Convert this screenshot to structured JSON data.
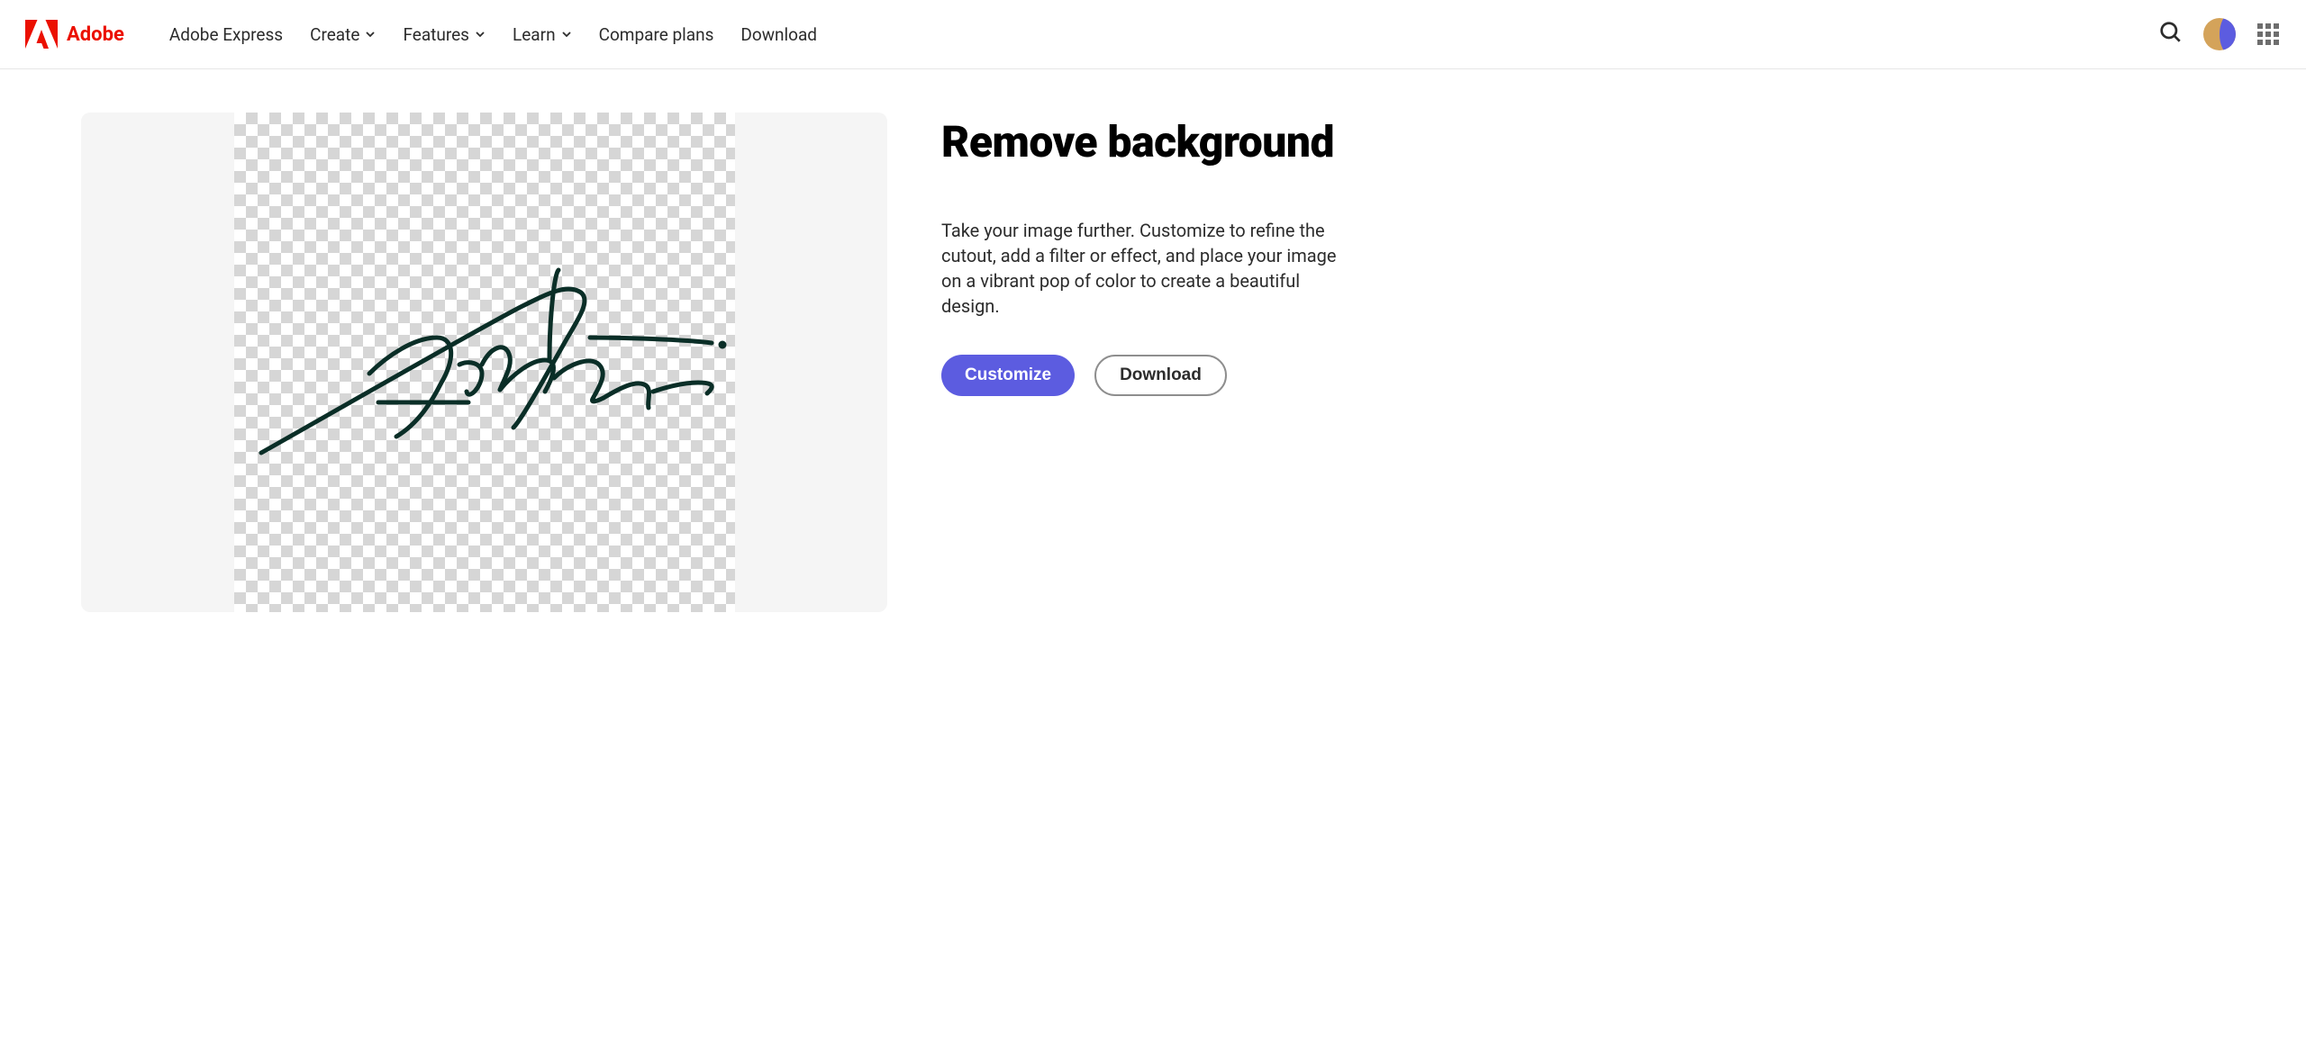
{
  "brand": "Adobe",
  "nav": {
    "express": "Adobe Express",
    "create": "Create",
    "features": "Features",
    "learn": "Learn",
    "compare": "Compare plans",
    "download": "Download"
  },
  "page": {
    "title": "Remove background",
    "description": "Take your image further. Customize to refine the cutout, add a filter or effect, and place your image on a vibrant pop of color to create a beautiful design."
  },
  "actions": {
    "customize": "Customize",
    "download": "Download"
  }
}
